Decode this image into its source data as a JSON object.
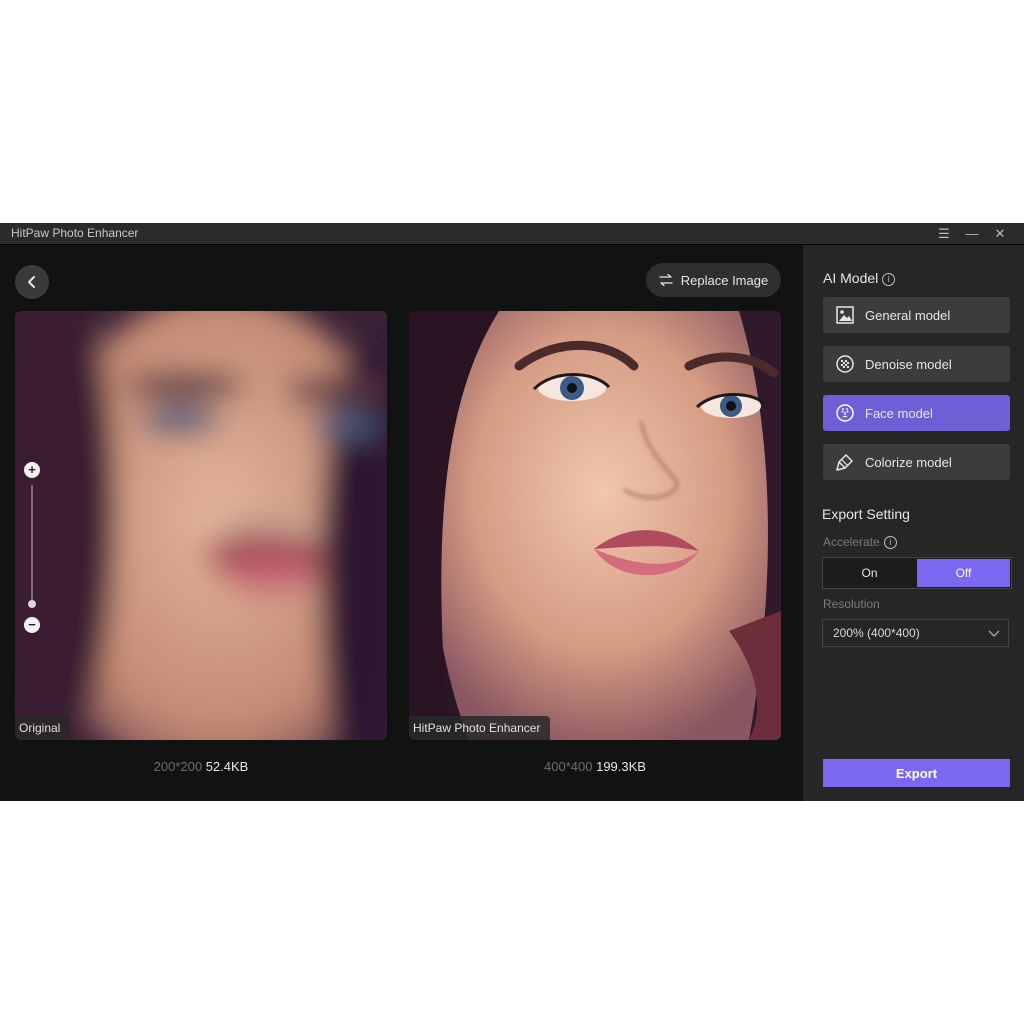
{
  "window": {
    "title": "HitPaw Photo Enhancer",
    "controls": {
      "menu_icon": "☰",
      "minimize_icon": "—",
      "close_icon": "✕"
    }
  },
  "toolbar": {
    "replace_label": "Replace Image"
  },
  "original": {
    "label": "Original",
    "dimensions": "200*200",
    "size": "52.4KB"
  },
  "enhanced": {
    "label": "HitPaw Photo Enhancer",
    "dimensions": "400*400",
    "size": "199.3KB"
  },
  "zoom": {
    "plus": "+",
    "minus": "−"
  },
  "sidebar": {
    "ai_model_title": "AI Model",
    "info_glyph": "i",
    "models": [
      {
        "label": "General model",
        "icon": "image-icon",
        "active": false
      },
      {
        "label": "Denoise model",
        "icon": "denoise-icon",
        "active": false
      },
      {
        "label": "Face model",
        "icon": "face-icon",
        "active": true
      },
      {
        "label": "Colorize model",
        "icon": "brush-icon",
        "active": false
      }
    ],
    "export_setting_title": "Export Setting",
    "accelerate_label": "Accelerate",
    "accelerate": {
      "on": "On",
      "off": "Off",
      "selected": "Off"
    },
    "resolution_label": "Resolution",
    "resolution_value": "200% (400*400)",
    "export_label": "Export"
  },
  "colors": {
    "accent": "#7b68f0",
    "active_model": "#6f5fd6",
    "panel_bg": "#262626",
    "main_bg": "#121212"
  }
}
